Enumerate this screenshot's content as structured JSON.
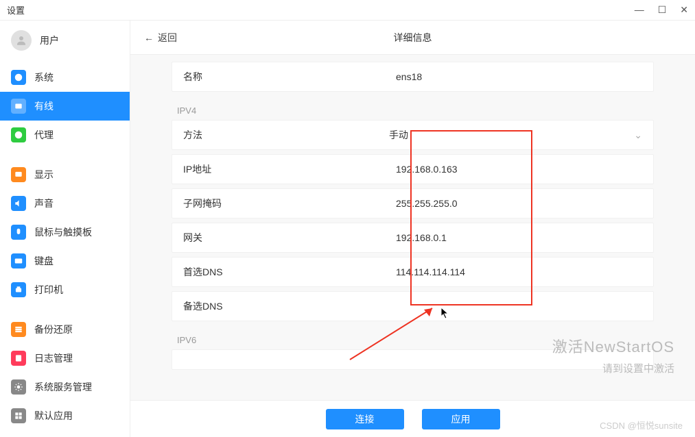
{
  "window": {
    "title": "设置"
  },
  "sidebar": {
    "user_label": "用户",
    "items": [
      {
        "label": "系统",
        "color": "#1f8fff"
      },
      {
        "label": "有线",
        "color": "#1f8fff",
        "active": true
      },
      {
        "label": "代理",
        "color": "#2ecc40"
      },
      {
        "label": "显示",
        "color": "#ff8a1f"
      },
      {
        "label": "声音",
        "color": "#1f8fff"
      },
      {
        "label": "鼠标与触摸板",
        "color": "#1f8fff"
      },
      {
        "label": "键盘",
        "color": "#1f8fff"
      },
      {
        "label": "打印机",
        "color": "#1f8fff"
      },
      {
        "label": "备份还原",
        "color": "#ff8a1f"
      },
      {
        "label": "日志管理",
        "color": "#ff3b5b"
      },
      {
        "label": "系统服务管理",
        "color": "#888"
      },
      {
        "label": "默认应用",
        "color": "#888"
      }
    ]
  },
  "header": {
    "back": "返回",
    "title": "详细信息"
  },
  "form": {
    "name_label": "名称",
    "name_value": "ens18",
    "ipv4_label": "IPV4",
    "method_label": "方法",
    "method_value": "手动",
    "ip_label": "IP地址",
    "ip_value": "192.168.0.163",
    "mask_label": "子网掩码",
    "mask_value": "255.255.255.0",
    "gateway_label": "网关",
    "gateway_value": "192.168.0.1",
    "dns1_label": "首选DNS",
    "dns1_value": "114.114.114.114",
    "dns2_label": "备选DNS",
    "dns2_value": "",
    "ipv6_label": "IPV6"
  },
  "footer": {
    "connect": "连接",
    "apply": "应用"
  },
  "watermark": {
    "line1": "激活NewStartOS",
    "line2": "请到设置中激活",
    "csdn": "CSDN @恒悦sunsite"
  }
}
